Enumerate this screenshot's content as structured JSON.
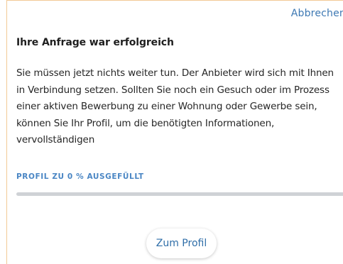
{
  "header": {
    "cancel_label": "Abbrechen"
  },
  "dialog": {
    "title": "Ihre Anfrage war erfolgreich",
    "message": "Sie müssen jetzt nichts weiter tun. Der Anbieter wird sich mit Ihnen in Verbindung setzen. Sollten Sie noch ein Gesuch oder im Prozess einer aktiven Bewerbung zu einer Wohnung oder Gewerbe sein, können Sie Ihr Profil, um die benötigten Informationen, vervollständigen"
  },
  "progress": {
    "label": "PROFIL ZU 0 % AUSGEFÜLLT",
    "percent": 0
  },
  "actions": {
    "profile_button_label": "Zum Profil"
  },
  "colors": {
    "accent": "#4a86c4",
    "link": "#3d78b3",
    "border": "#f2c996",
    "track": "#cfd2d6"
  }
}
